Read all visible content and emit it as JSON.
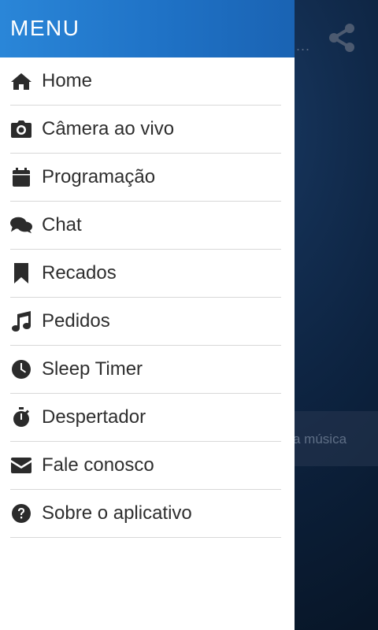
{
  "menu": {
    "title": "MENU",
    "items": [
      {
        "label": "Home",
        "icon": "home-icon"
      },
      {
        "label": "Câmera ao vivo",
        "icon": "camera-icon"
      },
      {
        "label": "Programação",
        "icon": "calendar-icon"
      },
      {
        "label": "Chat",
        "icon": "chat-icon"
      },
      {
        "label": "Recados",
        "icon": "bookmark-icon"
      },
      {
        "label": "Pedidos",
        "icon": "music-note-icon"
      },
      {
        "label": "Sleep Timer",
        "icon": "clock-icon"
      },
      {
        "label": "Despertador",
        "icon": "stopwatch-icon"
      },
      {
        "label": "Fale conosco",
        "icon": "envelope-icon"
      },
      {
        "label": "Sobre o aplicativo",
        "icon": "question-circle-icon"
      }
    ]
  },
  "background": {
    "partial_text": "a música",
    "more_indicator": "...",
    "share_icon": "share-icon"
  }
}
